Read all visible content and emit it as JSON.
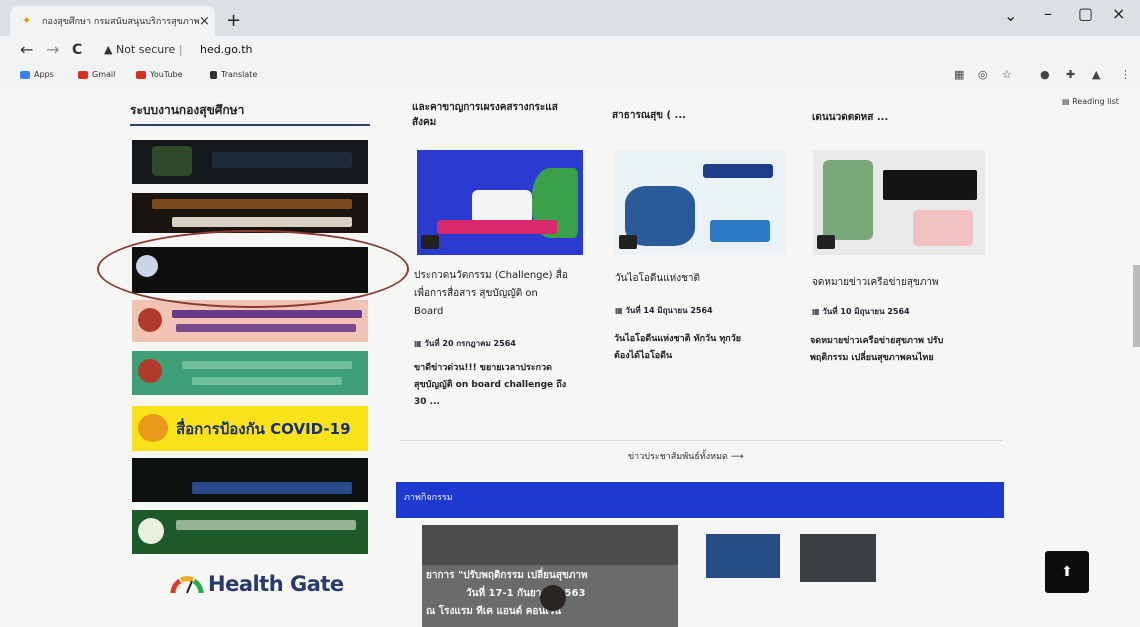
{
  "browser": {
    "tab_title": "กองสุขศึกษา กรมสนับสนุนบริการสุขภาพ",
    "tab_close": "×",
    "new_tab": "+",
    "window": {
      "minimize": "–",
      "maximize": "▢",
      "close": "×",
      "dropdown": "⌄"
    },
    "nav": {
      "back": "←",
      "forward": "→",
      "reload": "C"
    },
    "security": "Not secure",
    "url": "hed.go.th",
    "bookmarks": [
      {
        "label": "Apps",
        "color": "#3b82f6"
      },
      {
        "label": "Gmail",
        "color": "#d93025"
      },
      {
        "label": "YouTube",
        "color": "#d93025"
      },
      {
        "label": "Translate",
        "color": "#333333"
      }
    ],
    "reading_list": "Reading list"
  },
  "sidebar": {
    "title": "ระบบงานกองสุขศึกษา",
    "covid_banner": "สื่อการป้องกัน COVID-19",
    "health_gate": "Health Gate"
  },
  "news": [
    {
      "column_heading": "และคาขาญการเผรงคสรางกระแส สังคม",
      "title_lines": [
        "ประกวดนวัตกรรม (Challenge) สื่อ",
        "เพื่อการสื่อสาร สุขบัญญัติ on",
        "Board"
      ],
      "date": "วันที่ 20 กรกฎาคม 2564",
      "desc_lines": [
        "ขาดีข่าวด่วน!!! ขยายเวลาประกวด",
        "สุขบัญญัติ on board challenge ถึง",
        "30 ..."
      ]
    },
    {
      "column_heading": "สาธารณสุข ( ...",
      "title_lines": [
        "วันไอโอดีนแห่งชาติ"
      ],
      "date": "วันที่ 14 มิถุนายน 2564",
      "desc_lines": [
        "วันไอโอดีนแห่งชาติ ทักวัน ทุกวัย",
        "ต้องได้ไอโอดีน"
      ]
    },
    {
      "column_heading": "เดนนวดตดหส ...",
      "title_lines": [
        "จดหมายข่าวเครือข่ายสุขภาพ"
      ],
      "date": "วันที่ 10 มิถุนายน 2564",
      "desc_lines": [
        "จดหมายข่าวเครือข่ายสุขภาพ ปรับ",
        "พฤติกรรม เปลี่ยนสุขภาพคนไทย"
      ]
    }
  ],
  "all_news_link": "ข่าวประชาสัมพันธ์ทั้งหมด ⟶",
  "gallery": {
    "heading": "ภาพกิจกรรม",
    "main_caption_lines": [
      "ยาการ \"ปรับพฤติกรรม เปลี่ยนสุขภาพ",
      "วันที่ 17-1 กันยายน 2563",
      "ณ โรงแรม ทีเค แอนด์ คอนเวน"
    ]
  },
  "back_to_top": "⬆"
}
